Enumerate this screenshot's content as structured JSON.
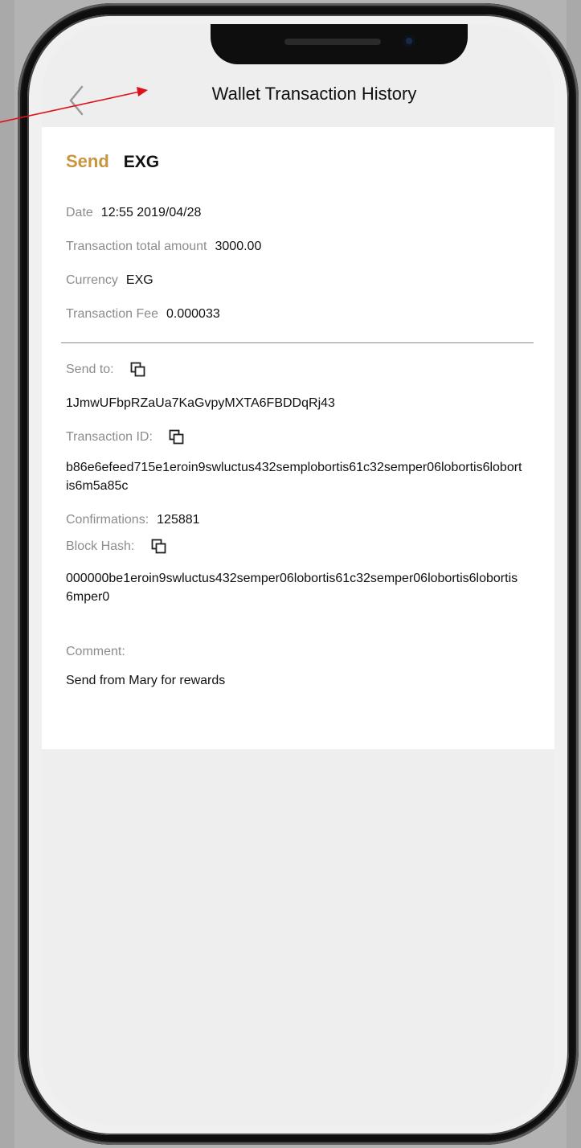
{
  "header": {
    "title": "Wallet Transaction History",
    "back_icon": "chevron-left-icon"
  },
  "transaction": {
    "type_label": "Send",
    "currency_code": "EXG",
    "date_label": "Date",
    "date_value": "12:55 2019/04/28",
    "total_label": "Transaction total amount",
    "total_value": "3000.00",
    "currency_label": "Currency",
    "currency_value": "EXG",
    "fee_label": "Transaction Fee",
    "fee_value": "0.000033",
    "send_to_label": "Send to:",
    "send_to_value": "1JmwUFbpRZaUa7KaGvpyMXTA6FBDDqRj43",
    "txid_label": "Transaction ID:",
    "txid_value": "b86e6efeed715e1eroin9swluctus432semplobortis61c32semper06lobortis6lobortis6m5a85c",
    "confirmations_label": "Confirmations:",
    "confirmations_value": "125881",
    "block_hash_label": "Block Hash:",
    "block_hash_value": "000000be1eroin9swluctus432semper06lobortis61c32semper06lobortis6lobortis6mper0",
    "comment_label": "Comment:",
    "comment_value": "Send from Mary for rewards"
  },
  "colors": {
    "send_accent": "#c8963e",
    "annotation_arrow": "#e0101a"
  }
}
